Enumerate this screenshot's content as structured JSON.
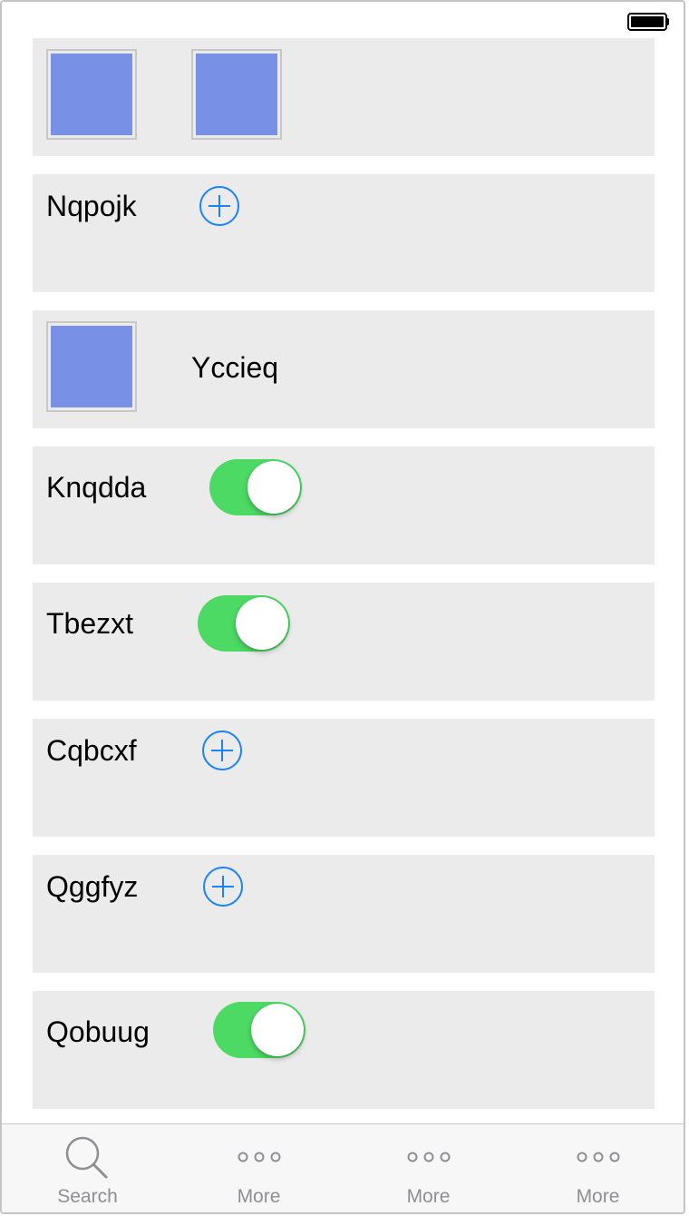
{
  "status_bar": {
    "battery_icon": "battery-full-icon"
  },
  "cells": [
    {
      "type": "images"
    },
    {
      "type": "add",
      "label": "Nqpojk"
    },
    {
      "type": "image-label",
      "label": "Yccieq"
    },
    {
      "type": "toggle",
      "label": "Knqdda",
      "on": true
    },
    {
      "type": "toggle",
      "label": "Tbezxt",
      "on": true
    },
    {
      "type": "add",
      "label": "Cqbcxf"
    },
    {
      "type": "add",
      "label": "Qggfyz"
    },
    {
      "type": "toggle",
      "label": "Qobuug",
      "on": true
    }
  ],
  "colors": {
    "accent": "#1a82fb",
    "toggle_on": "#4cd964",
    "image_fill": "#7891e6",
    "cell_bg": "#ebebeb",
    "tab_inactive": "#8e8e93"
  },
  "tabbar": {
    "tabs": [
      {
        "label": "Search",
        "icon": "search-icon"
      },
      {
        "label": "More",
        "icon": "more-icon"
      },
      {
        "label": "More",
        "icon": "more-icon"
      },
      {
        "label": "More",
        "icon": "more-icon"
      }
    ]
  }
}
